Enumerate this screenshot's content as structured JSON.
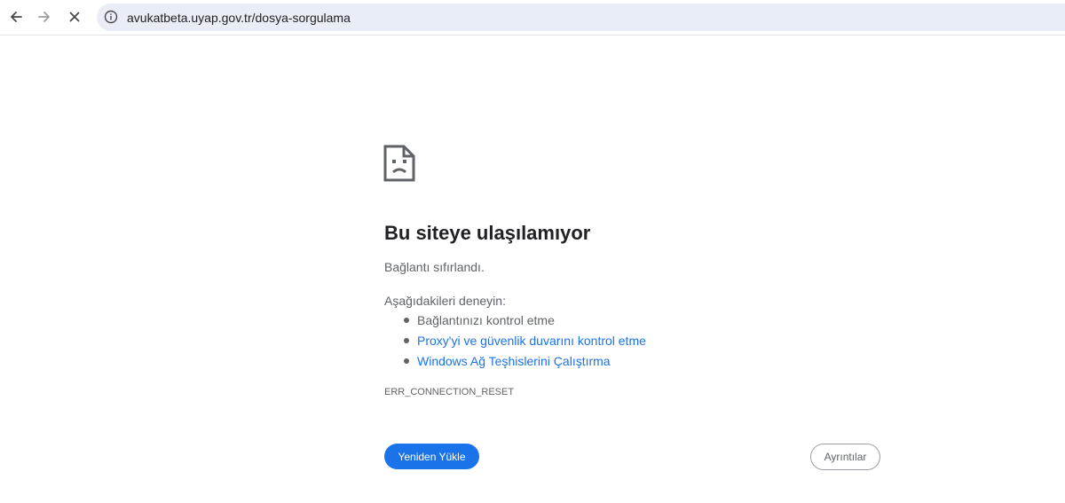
{
  "browser": {
    "url": "avukatbeta.uyap.gov.tr/dosya-sorgulama",
    "back_icon": "arrow-left-icon",
    "forward_icon": "arrow-right-icon",
    "stop_icon": "close-icon",
    "site_info_icon": "info-icon"
  },
  "error": {
    "icon": "sad-page-icon",
    "title": "Bu siteye ulaşılamıyor",
    "subtitle": "Bağlantı sıfırlandı.",
    "try_label": "Aşağıdakileri deneyin:",
    "suggestions": [
      {
        "text": "Bağlantınızı kontrol etme",
        "link": false
      },
      {
        "text": "Proxy'yi ve güvenlik duvarını kontrol etme",
        "link": true
      },
      {
        "text": "Windows Ağ Teşhislerini Çalıştırma",
        "link": true
      }
    ],
    "code": "ERR_CONNECTION_RESET",
    "reload_label": "Yeniden Yükle",
    "details_label": "Ayrıntılar"
  },
  "colors": {
    "accent": "#1a73e8",
    "text_secondary": "#5f6368",
    "omnibox_bg": "#e9eef6"
  }
}
